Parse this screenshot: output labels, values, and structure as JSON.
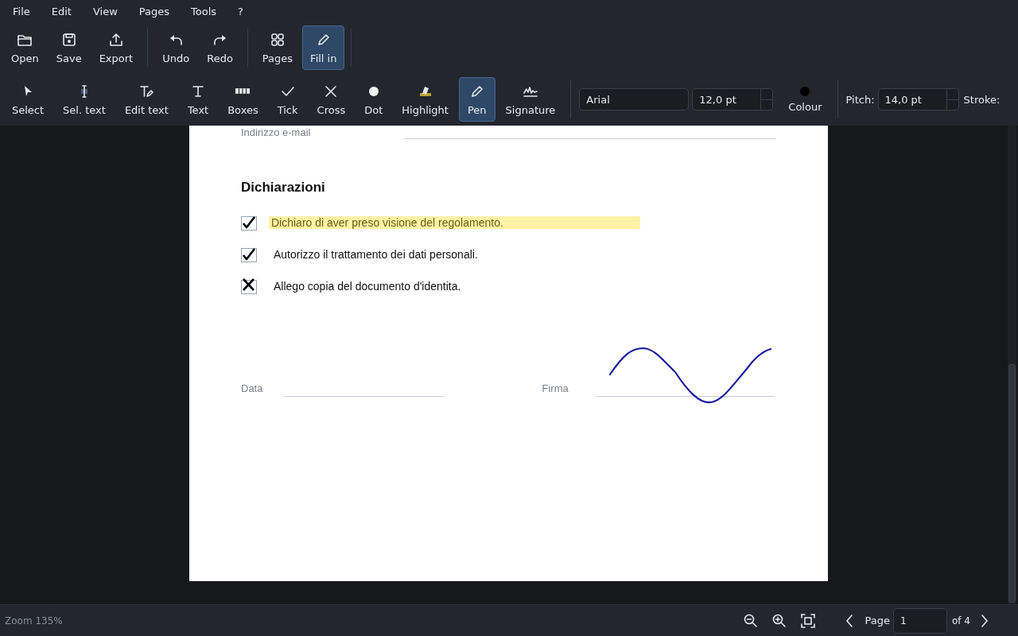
{
  "menu": [
    "File",
    "Edit",
    "View",
    "Pages",
    "Tools",
    "?"
  ],
  "main_toolbar": [
    [
      {
        "kind": "open",
        "label": "Open",
        "selected": false
      },
      {
        "kind": "save",
        "label": "Save",
        "selected": false
      },
      {
        "kind": "export",
        "label": "Export",
        "selected": false
      }
    ],
    [
      {
        "kind": "undo",
        "label": "Undo",
        "selected": false
      },
      {
        "kind": "redo",
        "label": "Redo",
        "selected": false
      }
    ],
    [
      {
        "kind": "pages",
        "label": "Pages",
        "selected": false
      },
      {
        "kind": "fill",
        "label": "Fill in",
        "selected": true
      }
    ]
  ],
  "tools": [
    {
      "kind": "select",
      "label": "Select",
      "selected": false
    },
    {
      "kind": "seltext",
      "label": "Sel. text",
      "selected": false
    },
    {
      "kind": "edittext",
      "label": "Edit text",
      "selected": false
    },
    {
      "kind": "text",
      "label": "Text",
      "selected": false
    },
    {
      "kind": "boxes",
      "label": "Boxes",
      "selected": false
    },
    {
      "kind": "tick",
      "label": "Tick",
      "selected": false
    },
    {
      "kind": "cross",
      "label": "Cross",
      "selected": false
    },
    {
      "kind": "dot",
      "label": "Dot",
      "selected": false
    },
    {
      "kind": "highlight",
      "label": "Highlight",
      "selected": false
    },
    {
      "kind": "pen",
      "label": "Pen",
      "selected": true
    },
    {
      "kind": "signature",
      "label": "Signature",
      "selected": false
    }
  ],
  "font": {
    "value": "Arial"
  },
  "size": {
    "value": "12,0 pt"
  },
  "colour": {
    "label": "Colour",
    "color": "#000000"
  },
  "pitch": {
    "label": "Pitch:",
    "value": "14,0 pt"
  },
  "stroke": {
    "label": "Stroke:"
  },
  "document": {
    "email_label": "Indirizzo e-mail",
    "heading": "Dichiarazioni",
    "items": [
      {
        "kind": "tick",
        "checked": true,
        "text": "Dichiaro di aver preso visione del regolamento.",
        "highlighted": true
      },
      {
        "kind": "tick",
        "checked": true,
        "text": "Autorizzo il trattamento dei dati personali.",
        "highlighted": false
      },
      {
        "kind": "cross",
        "checked": true,
        "text": "Allego copia del documento d'identita.",
        "highlighted": false
      }
    ],
    "date_label": "Data",
    "signature_label": "Firma"
  },
  "status_bar": {
    "zoom": "Zoom 135%",
    "page_label": "Page",
    "page": "1",
    "page_total": "of 4"
  }
}
